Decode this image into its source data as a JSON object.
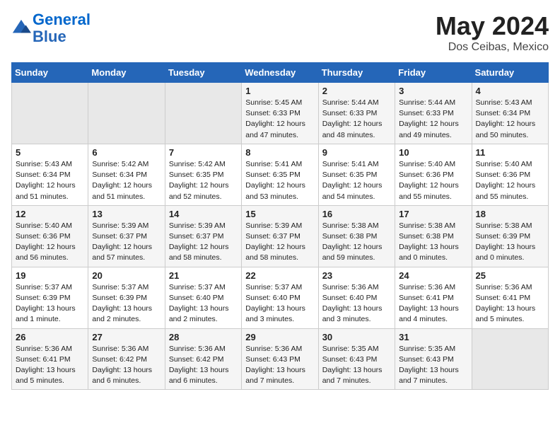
{
  "header": {
    "logo_line1": "General",
    "logo_line2": "Blue",
    "month": "May 2024",
    "location": "Dos Ceibas, Mexico"
  },
  "weekdays": [
    "Sunday",
    "Monday",
    "Tuesday",
    "Wednesday",
    "Thursday",
    "Friday",
    "Saturday"
  ],
  "weeks": [
    [
      {
        "day": "",
        "empty": true
      },
      {
        "day": "",
        "empty": true
      },
      {
        "day": "",
        "empty": true
      },
      {
        "day": "1",
        "sunrise": "5:45 AM",
        "sunset": "6:33 PM",
        "daylight": "12 hours and 47 minutes."
      },
      {
        "day": "2",
        "sunrise": "5:44 AM",
        "sunset": "6:33 PM",
        "daylight": "12 hours and 48 minutes."
      },
      {
        "day": "3",
        "sunrise": "5:44 AM",
        "sunset": "6:33 PM",
        "daylight": "12 hours and 49 minutes."
      },
      {
        "day": "4",
        "sunrise": "5:43 AM",
        "sunset": "6:34 PM",
        "daylight": "12 hours and 50 minutes."
      }
    ],
    [
      {
        "day": "5",
        "sunrise": "5:43 AM",
        "sunset": "6:34 PM",
        "daylight": "12 hours and 51 minutes."
      },
      {
        "day": "6",
        "sunrise": "5:42 AM",
        "sunset": "6:34 PM",
        "daylight": "12 hours and 51 minutes."
      },
      {
        "day": "7",
        "sunrise": "5:42 AM",
        "sunset": "6:35 PM",
        "daylight": "12 hours and 52 minutes."
      },
      {
        "day": "8",
        "sunrise": "5:41 AM",
        "sunset": "6:35 PM",
        "daylight": "12 hours and 53 minutes."
      },
      {
        "day": "9",
        "sunrise": "5:41 AM",
        "sunset": "6:35 PM",
        "daylight": "12 hours and 54 minutes."
      },
      {
        "day": "10",
        "sunrise": "5:40 AM",
        "sunset": "6:36 PM",
        "daylight": "12 hours and 55 minutes."
      },
      {
        "day": "11",
        "sunrise": "5:40 AM",
        "sunset": "6:36 PM",
        "daylight": "12 hours and 55 minutes."
      }
    ],
    [
      {
        "day": "12",
        "sunrise": "5:40 AM",
        "sunset": "6:36 PM",
        "daylight": "12 hours and 56 minutes."
      },
      {
        "day": "13",
        "sunrise": "5:39 AM",
        "sunset": "6:37 PM",
        "daylight": "12 hours and 57 minutes."
      },
      {
        "day": "14",
        "sunrise": "5:39 AM",
        "sunset": "6:37 PM",
        "daylight": "12 hours and 58 minutes."
      },
      {
        "day": "15",
        "sunrise": "5:39 AM",
        "sunset": "6:37 PM",
        "daylight": "12 hours and 58 minutes."
      },
      {
        "day": "16",
        "sunrise": "5:38 AM",
        "sunset": "6:38 PM",
        "daylight": "12 hours and 59 minutes."
      },
      {
        "day": "17",
        "sunrise": "5:38 AM",
        "sunset": "6:38 PM",
        "daylight": "13 hours and 0 minutes."
      },
      {
        "day": "18",
        "sunrise": "5:38 AM",
        "sunset": "6:39 PM",
        "daylight": "13 hours and 0 minutes."
      }
    ],
    [
      {
        "day": "19",
        "sunrise": "5:37 AM",
        "sunset": "6:39 PM",
        "daylight": "13 hours and 1 minute."
      },
      {
        "day": "20",
        "sunrise": "5:37 AM",
        "sunset": "6:39 PM",
        "daylight": "13 hours and 2 minutes."
      },
      {
        "day": "21",
        "sunrise": "5:37 AM",
        "sunset": "6:40 PM",
        "daylight": "13 hours and 2 minutes."
      },
      {
        "day": "22",
        "sunrise": "5:37 AM",
        "sunset": "6:40 PM",
        "daylight": "13 hours and 3 minutes."
      },
      {
        "day": "23",
        "sunrise": "5:36 AM",
        "sunset": "6:40 PM",
        "daylight": "13 hours and 3 minutes."
      },
      {
        "day": "24",
        "sunrise": "5:36 AM",
        "sunset": "6:41 PM",
        "daylight": "13 hours and 4 minutes."
      },
      {
        "day": "25",
        "sunrise": "5:36 AM",
        "sunset": "6:41 PM",
        "daylight": "13 hours and 5 minutes."
      }
    ],
    [
      {
        "day": "26",
        "sunrise": "5:36 AM",
        "sunset": "6:41 PM",
        "daylight": "13 hours and 5 minutes."
      },
      {
        "day": "27",
        "sunrise": "5:36 AM",
        "sunset": "6:42 PM",
        "daylight": "13 hours and 6 minutes."
      },
      {
        "day": "28",
        "sunrise": "5:36 AM",
        "sunset": "6:42 PM",
        "daylight": "13 hours and 6 minutes."
      },
      {
        "day": "29",
        "sunrise": "5:36 AM",
        "sunset": "6:43 PM",
        "daylight": "13 hours and 7 minutes."
      },
      {
        "day": "30",
        "sunrise": "5:35 AM",
        "sunset": "6:43 PM",
        "daylight": "13 hours and 7 minutes."
      },
      {
        "day": "31",
        "sunrise": "5:35 AM",
        "sunset": "6:43 PM",
        "daylight": "13 hours and 7 minutes."
      },
      {
        "day": "",
        "empty": true
      }
    ]
  ]
}
